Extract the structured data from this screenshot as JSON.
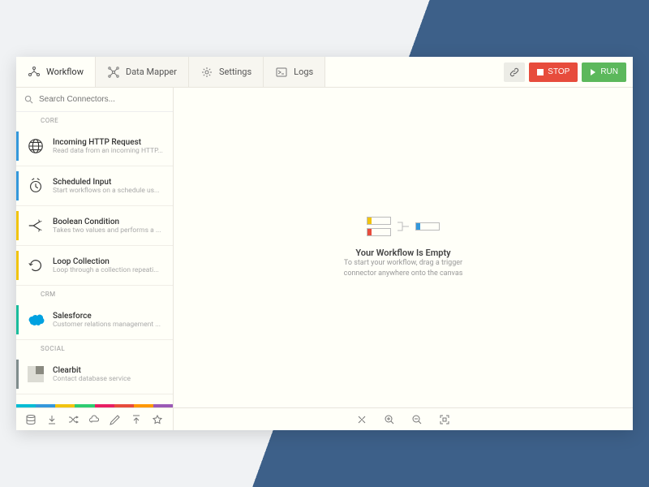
{
  "header": {
    "tabs": [
      {
        "label": "Workflow",
        "active": true
      },
      {
        "label": "Data Mapper",
        "active": false
      },
      {
        "label": "Settings",
        "active": false
      },
      {
        "label": "Logs",
        "active": false
      }
    ],
    "stop_label": "STOP",
    "run_label": "RUN"
  },
  "sidebar": {
    "search_placeholder": "Search Connectors...",
    "sections": [
      {
        "label": "CORE",
        "items": [
          {
            "title": "Incoming HTTP Request",
            "desc": "Read data from an incoming HTTP...",
            "accent": "blue",
            "icon": "globe-icon"
          },
          {
            "title": "Scheduled Input",
            "desc": "Start workflows on a schedule us...",
            "accent": "blue",
            "icon": "clock-icon"
          },
          {
            "title": "Boolean Condition",
            "desc": "Takes two values and performs a ...",
            "accent": "yellow",
            "icon": "branch-icon"
          },
          {
            "title": "Loop Collection",
            "desc": "Loop through a collection repeati...",
            "accent": "yellow",
            "icon": "loop-icon"
          }
        ]
      },
      {
        "label": "CRM",
        "items": [
          {
            "title": "Salesforce",
            "desc": "Customer relations management ...",
            "accent": "teal",
            "icon": "salesforce-icon"
          }
        ]
      },
      {
        "label": "SOCIAL",
        "items": [
          {
            "title": "Clearbit",
            "desc": "Contact database service",
            "accent": "gray",
            "icon": "clearbit-icon"
          }
        ]
      }
    ],
    "color_strip": [
      "#00bcd4",
      "#3498db",
      "#f1c40f",
      "#2ecc71",
      "#e91e63",
      "#e74c3c",
      "#ff9800",
      "#9b59b6"
    ]
  },
  "canvas": {
    "empty_title": "Your Workflow Is Empty",
    "empty_desc_l1": "To start your workflow, drag a trigger",
    "empty_desc_l2": "connector anywhere onto the canvas"
  }
}
